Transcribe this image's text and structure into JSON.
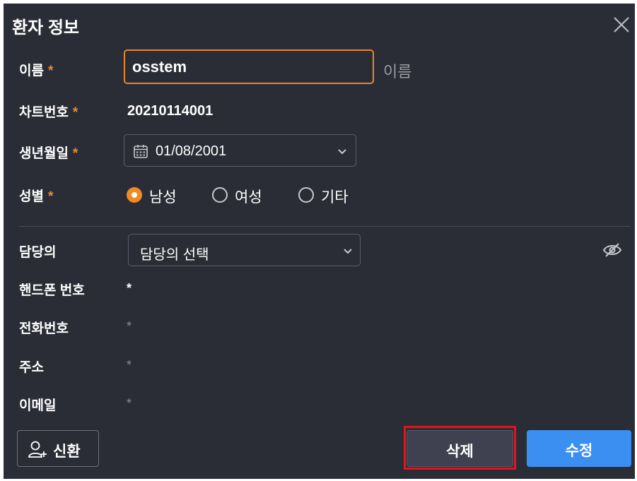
{
  "dialog": {
    "title": "환자 정보"
  },
  "fields": {
    "name": {
      "label": "이름",
      "required_mark": "*",
      "value": "osstem",
      "hint": "이름"
    },
    "chart_no": {
      "label": "차트번호",
      "required_mark": "*",
      "value": "20210114001"
    },
    "birth": {
      "label": "생년월일",
      "required_mark": "*",
      "value": "01/08/2001"
    },
    "gender": {
      "label": "성별",
      "required_mark": "*",
      "options": [
        "남성",
        "여성",
        "기타"
      ],
      "selected": "남성"
    },
    "doctor": {
      "label": "담당의",
      "value": "담당의 선택"
    },
    "mobile": {
      "label": "핸드폰 번호",
      "value": "*"
    },
    "phone": {
      "label": "전화번호",
      "value": "*"
    },
    "address": {
      "label": "주소",
      "value": "*"
    },
    "email": {
      "label": "이메일",
      "value": "*"
    }
  },
  "buttons": {
    "new_patient": "신환",
    "delete": "삭제",
    "edit": "수정"
  },
  "colors": {
    "background": "#2b2d36",
    "accent_orange": "#f28a22",
    "primary_blue": "#3b8ff0",
    "highlight_red": "#e3141c"
  },
  "icons": [
    "close-icon",
    "calendar-icon",
    "chevron-down-icon",
    "eye-off-icon",
    "add-user-icon"
  ]
}
